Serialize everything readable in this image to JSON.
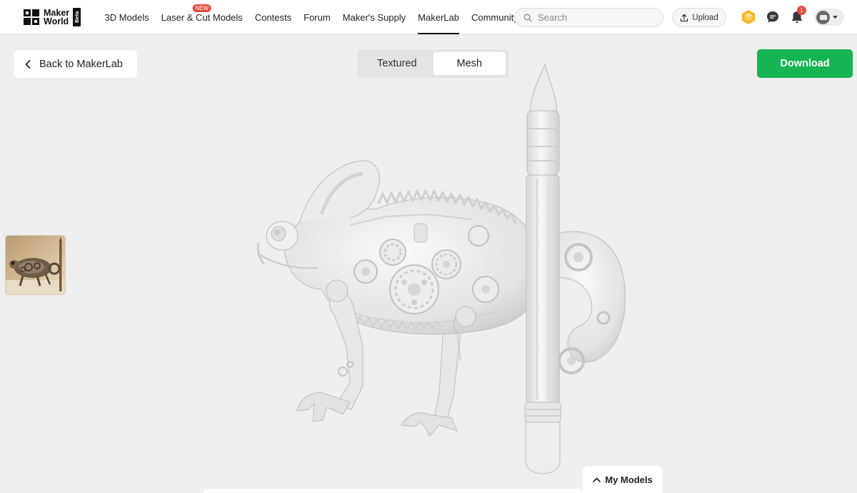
{
  "header": {
    "logo": {
      "line1": "Maker",
      "line2": "World",
      "badge": "Beta"
    },
    "nav": [
      {
        "label": "3D Models",
        "active": false
      },
      {
        "label": "Laser & Cut Models",
        "active": false,
        "badge": "NEW"
      },
      {
        "label": "Contests",
        "active": false
      },
      {
        "label": "Forum",
        "active": false
      },
      {
        "label": "Maker's Supply",
        "active": false
      },
      {
        "label": "MakerLab",
        "active": true
      },
      {
        "label": "Community",
        "active": false
      }
    ],
    "search": {
      "placeholder": "Search",
      "icon": "search-icon"
    },
    "upload_label": "Upload",
    "notifications_count": "1",
    "icons": [
      "points-icon",
      "chat-icon",
      "bell-icon",
      "avatar",
      "chevron-down-icon"
    ]
  },
  "controls": {
    "back_label": "Back to MakerLab",
    "toggle": {
      "textured": "Textured",
      "mesh": "Mesh",
      "active": "mesh"
    },
    "download_label": "Download"
  },
  "footer": {
    "my_models_label": "My Models"
  },
  "colors": {
    "accent_green": "#16b453",
    "badge_red": "#ea4b40",
    "canvas_bg": "#efefef"
  }
}
